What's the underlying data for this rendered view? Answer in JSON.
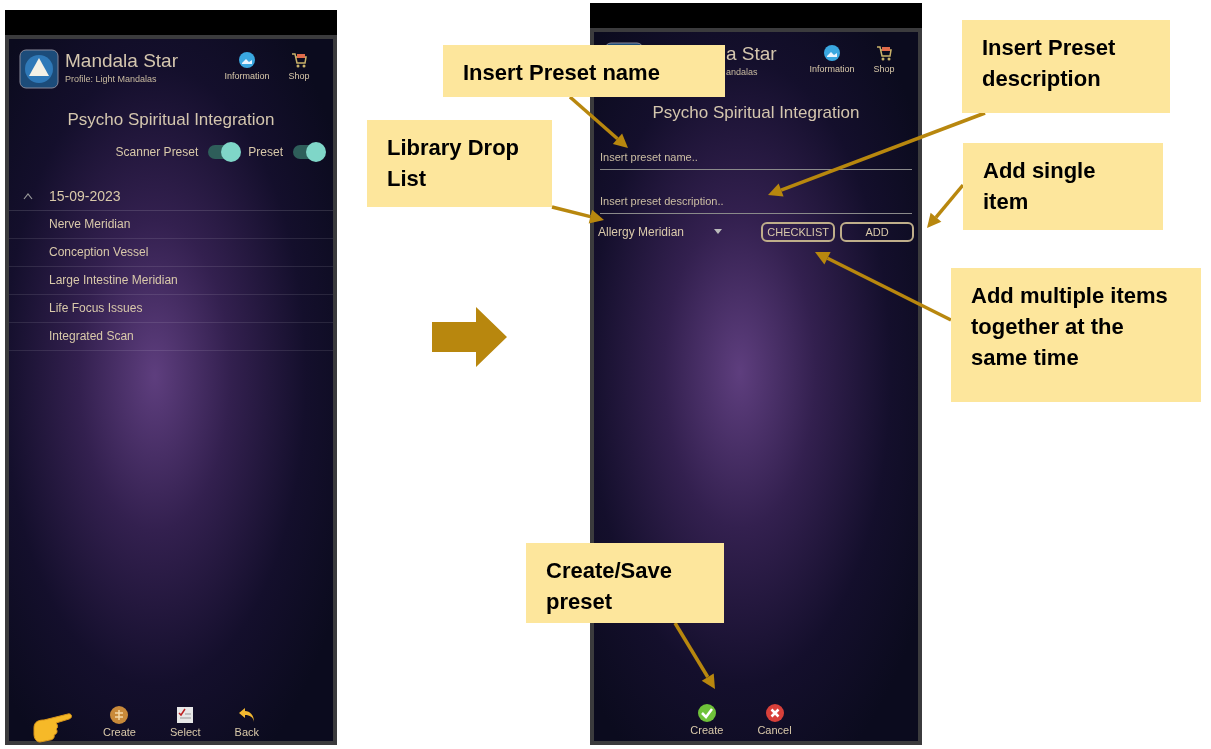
{
  "left_screen": {
    "app_title": "Mandala Star",
    "profile": "Profile: Light Mandalas",
    "header_actions": [
      {
        "kind": "info",
        "label": "Information"
      },
      {
        "kind": "shop",
        "label": "Shop"
      }
    ],
    "page_title": "Psycho Spiritual Integration",
    "toggles": [
      {
        "label": "Scanner Preset",
        "on": true
      },
      {
        "label": "Preset",
        "on": true
      }
    ],
    "group": {
      "label": "15-09-2023",
      "expanded": true,
      "children": [
        {
          "label": "Nerve Meridian"
        },
        {
          "label": "Conception Vessel"
        },
        {
          "label": "Large Intestine Meridian"
        },
        {
          "label": "Life Focus Issues"
        },
        {
          "label": "Integrated Scan"
        }
      ]
    },
    "bottom_nav": [
      {
        "kind": "create",
        "label": "Create"
      },
      {
        "kind": "select",
        "label": "Select"
      },
      {
        "kind": "back",
        "label": "Back"
      }
    ]
  },
  "right_screen": {
    "app_title": "a Star",
    "profile": "andalas",
    "header_actions": [
      {
        "kind": "info",
        "label": "Information"
      },
      {
        "kind": "shop",
        "label": "Shop"
      }
    ],
    "page_title": "Psycho Spiritual Integration",
    "fields": [
      {
        "placeholder": "Insert preset name.."
      },
      {
        "placeholder": "Insert preset description.."
      }
    ],
    "dropdown": {
      "value": "Allergy Meridian"
    },
    "buttons": [
      {
        "label": "CHECKLIST"
      },
      {
        "label": "ADD"
      }
    ],
    "bottom_actions": [
      {
        "kind": "confirm",
        "label": "Create"
      },
      {
        "kind": "cancel",
        "label": "Cancel"
      }
    ]
  },
  "callouts": [
    {
      "text": "Insert Preset name"
    },
    {
      "text": "Insert Preset description"
    },
    {
      "text": "Library Drop List"
    },
    {
      "text": "Add single item"
    },
    {
      "text": "Add multiple items together at the same time"
    },
    {
      "text": "Create/Save preset"
    }
  ]
}
